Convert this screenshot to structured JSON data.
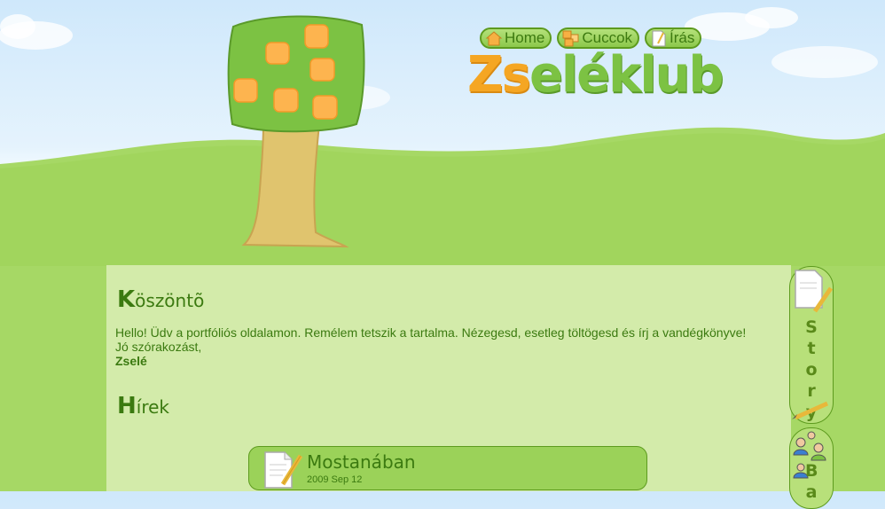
{
  "colors": {
    "accent": "#7cc243",
    "logo_orange": "#f5a623",
    "text_green": "#3b7a10",
    "panel": "#d3ebaa"
  },
  "nav": [
    {
      "label": "Home",
      "icon": "home-icon"
    },
    {
      "label": "Cuccok",
      "icon": "boxes-icon"
    },
    {
      "label": "Írás",
      "icon": "paper-icon"
    }
  ],
  "logo": {
    "part1": "Zs",
    "part2": "eléklub"
  },
  "welcome": {
    "heading_cap": "K",
    "heading_rest": "öszöntõ",
    "line1": "Hello! Üdv a portfóliós oldalamon. Remélem tetszik a tartalma. Nézegesd, esetleg töltögesd és írj a vandégkönyve!",
    "line2": "Jó szórakozást,",
    "signature": "Zselé"
  },
  "news": {
    "heading_cap": "H",
    "heading_rest": "írek",
    "item_title": "Mostanában",
    "item_date": "2009 Sep 12"
  },
  "side_tabs": {
    "story_letters": [
      "S",
      "t",
      "o",
      "r",
      "y"
    ],
    "second_letters": [
      "B",
      "a"
    ]
  }
}
